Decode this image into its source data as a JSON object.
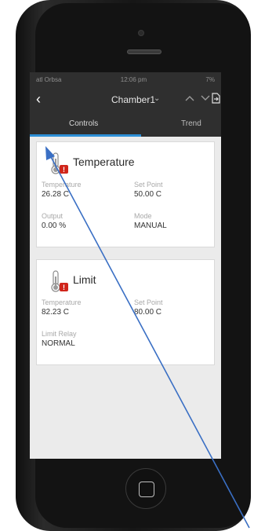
{
  "status_bar": {
    "carrier": "atl Orbsa",
    "time": "12:06 pm",
    "battery": "7%"
  },
  "nav": {
    "back_label": "‹",
    "title": "Chamber1",
    "dropdown_icon": "chevron-down-icon"
  },
  "tabs": [
    {
      "label": "Controls",
      "active": true
    },
    {
      "label": "Trend",
      "active": false
    }
  ],
  "cards": [
    {
      "title": "Temperature",
      "icon": "thermometer-alarm-icon",
      "fields": [
        {
          "label": "Temperature",
          "value": "26.28 C"
        },
        {
          "label": "Set Point",
          "value": "50.00 C"
        },
        {
          "label": "Output",
          "value": "0.00 %"
        },
        {
          "label": "Mode",
          "value": "MANUAL"
        }
      ]
    },
    {
      "title": "Limit",
      "icon": "thermometer-alarm-icon",
      "fields": [
        {
          "label": "Temperature",
          "value": "82.23 C"
        },
        {
          "label": "Set Point",
          "value": "80.00 C"
        },
        {
          "label": "Limit Relay",
          "value": "NORMAL"
        }
      ]
    }
  ],
  "colors": {
    "accent": "#2d8fd6",
    "alarm": "#d0251b",
    "annotation": "#3a6fc4"
  }
}
